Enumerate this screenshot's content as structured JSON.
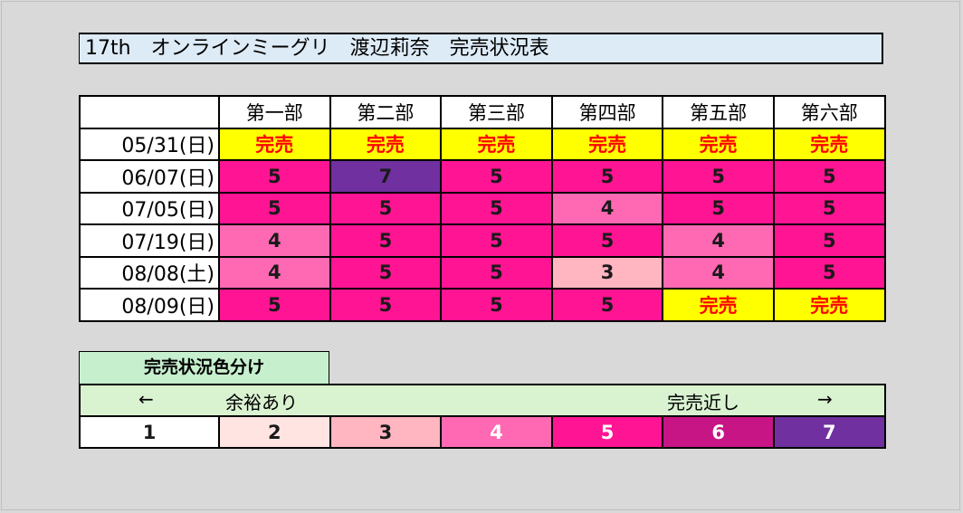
{
  "title": "17th　オンラインミーグリ　渡辺莉奈　完売状況表",
  "schedule": {
    "columns": [
      "第一部",
      "第二部",
      "第三部",
      "第四部",
      "第五部",
      "第六部"
    ],
    "sold_out_label": "完売",
    "rows": [
      {
        "date": "05/31(日)",
        "cells": [
          "完売",
          "完売",
          "完売",
          "完売",
          "完売",
          "完売"
        ]
      },
      {
        "date": "06/07(日)",
        "cells": [
          "5",
          "7",
          "5",
          "5",
          "5",
          "5"
        ]
      },
      {
        "date": "07/05(日)",
        "cells": [
          "5",
          "5",
          "5",
          "4",
          "5",
          "5"
        ]
      },
      {
        "date": "07/19(日)",
        "cells": [
          "4",
          "5",
          "5",
          "5",
          "4",
          "5"
        ]
      },
      {
        "date": "08/08(土)",
        "cells": [
          "4",
          "5",
          "5",
          "3",
          "4",
          "5"
        ]
      },
      {
        "date": "08/09(日)",
        "cells": [
          "5",
          "5",
          "5",
          "5",
          "完売",
          "完売"
        ]
      }
    ]
  },
  "legend": {
    "title": "完売状況色分け",
    "left_arrow": "←",
    "left_label": "余裕あり",
    "right_label": "完売近し",
    "right_arrow": "→",
    "levels": [
      "1",
      "2",
      "3",
      "4",
      "5",
      "6",
      "7"
    ]
  },
  "colors": {
    "sold_out_bg": "#ffff00",
    "sold_out_text": "#ff0000",
    "level_1": "#ffffff",
    "level_2": "#ffe4e1",
    "level_3": "#ffb6c1",
    "level_4": "#ff69b4",
    "level_5": "#ff1493",
    "level_6": "#c71585",
    "level_7": "#7030a0"
  }
}
